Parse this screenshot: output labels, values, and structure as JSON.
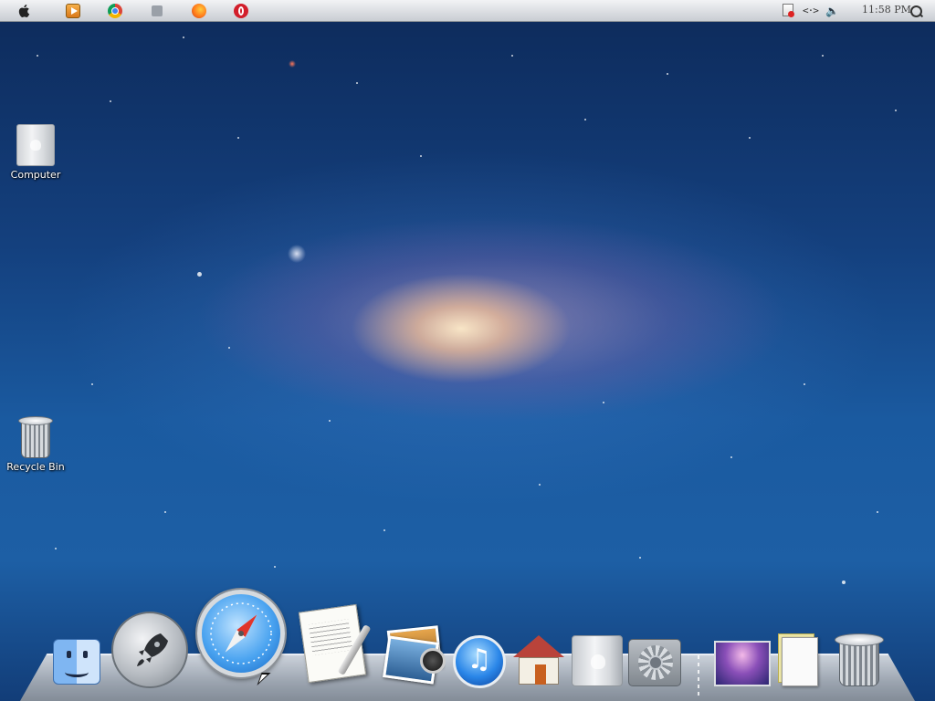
{
  "menubar": {
    "apple_icon": "apple-logo-icon",
    "apps": [
      {
        "name": "media-player-icon"
      },
      {
        "name": "chrome-icon"
      },
      {
        "name": "calendar-icon"
      },
      {
        "name": "firefox-icon"
      },
      {
        "name": "opera-icon"
      }
    ],
    "tray": {
      "network_glyph": "<·>",
      "volume_glyph": "🔈"
    },
    "clock": "11:58 PM"
  },
  "desktop": {
    "icons": [
      {
        "label": "Computer",
        "icon": "computer-icon"
      },
      {
        "label": "Recycle Bin",
        "icon": "recycle-bin-icon"
      }
    ]
  },
  "dock": {
    "items": [
      {
        "icon": "finder-icon"
      },
      {
        "icon": "launchpad-icon"
      },
      {
        "icon": "safari-icon"
      },
      {
        "icon": "textedit-icon"
      },
      {
        "icon": "photo-booth-icon"
      },
      {
        "icon": "itunes-icon"
      },
      {
        "icon": "home-folder-icon"
      },
      {
        "icon": "mac-pro-icon"
      },
      {
        "icon": "system-preferences-icon"
      },
      {
        "icon": "stack-wallpaper-icon"
      },
      {
        "icon": "documents-icon"
      },
      {
        "icon": "trash-icon"
      }
    ],
    "itunes_glyph": "♫"
  },
  "colors": {
    "menubar_top": "#f2f3f5",
    "menubar_bottom": "#c9cdd3",
    "desktop_blue": "#1a5aa0"
  }
}
